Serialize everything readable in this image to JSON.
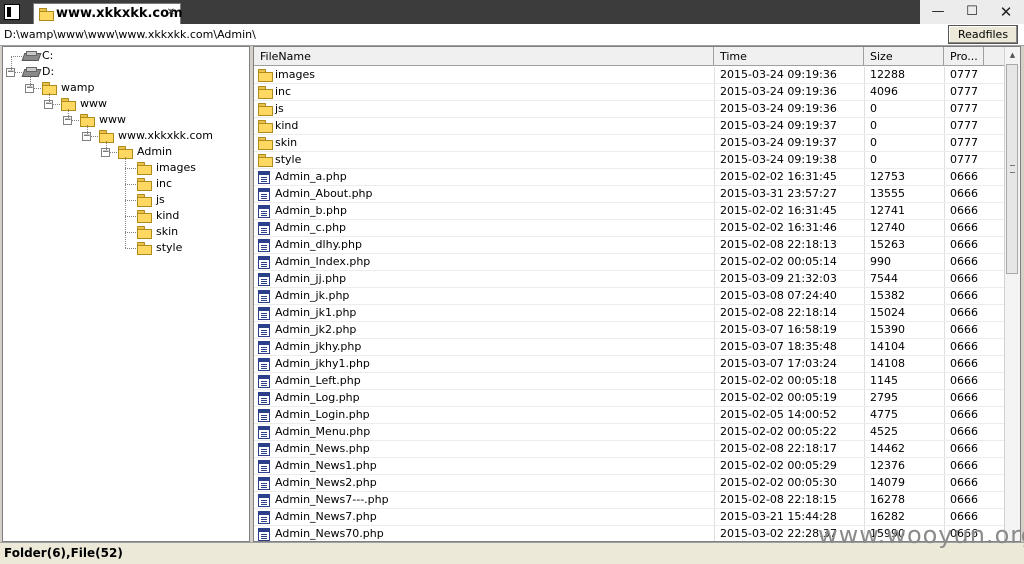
{
  "window": {
    "tab_title": "www.xkkxkk.com",
    "tab_close": "✕",
    "minimize": "—",
    "maximize": "☐",
    "close": "✕"
  },
  "pathbar": {
    "path": "D:\\wamp\\www\\www\\www.xkkxkk.com\\Admin\\",
    "readfiles_label": "Readfiles"
  },
  "tree": [
    {
      "label": "C:",
      "icon": "drive-icon",
      "depth": 0,
      "expander": "none"
    },
    {
      "label": "D:",
      "icon": "drive-icon",
      "depth": 0,
      "expander": "minus"
    },
    {
      "label": "wamp",
      "icon": "folder-icon",
      "depth": 1,
      "expander": "minus"
    },
    {
      "label": "www",
      "icon": "folder-icon",
      "depth": 2,
      "expander": "minus"
    },
    {
      "label": "www",
      "icon": "folder-icon",
      "depth": 3,
      "expander": "minus"
    },
    {
      "label": "www.xkkxkk.com",
      "icon": "folder-icon",
      "depth": 4,
      "expander": "minus"
    },
    {
      "label": "Admin",
      "icon": "folder-icon",
      "depth": 5,
      "expander": "minus"
    },
    {
      "label": "images",
      "icon": "folder-icon",
      "depth": 6,
      "expander": "none"
    },
    {
      "label": "inc",
      "icon": "folder-icon",
      "depth": 6,
      "expander": "none"
    },
    {
      "label": "js",
      "icon": "folder-icon",
      "depth": 6,
      "expander": "none"
    },
    {
      "label": "kind",
      "icon": "folder-icon",
      "depth": 6,
      "expander": "none"
    },
    {
      "label": "skin",
      "icon": "folder-icon",
      "depth": 6,
      "expander": "none"
    },
    {
      "label": "style",
      "icon": "folder-icon",
      "depth": 6,
      "expander": "none"
    }
  ],
  "file_list": {
    "columns": [
      "FileName",
      "Time",
      "Size",
      "Pro..."
    ],
    "rows": [
      {
        "type": "folder",
        "name": "images",
        "time": "2015-03-24 09:19:36",
        "size": "12288",
        "prop": "0777"
      },
      {
        "type": "folder",
        "name": "inc",
        "time": "2015-03-24 09:19:36",
        "size": "4096",
        "prop": "0777"
      },
      {
        "type": "folder",
        "name": "js",
        "time": "2015-03-24 09:19:36",
        "size": "0",
        "prop": "0777"
      },
      {
        "type": "folder",
        "name": "kind",
        "time": "2015-03-24 09:19:37",
        "size": "0",
        "prop": "0777"
      },
      {
        "type": "folder",
        "name": "skin",
        "time": "2015-03-24 09:19:37",
        "size": "0",
        "prop": "0777"
      },
      {
        "type": "folder",
        "name": "style",
        "time": "2015-03-24 09:19:38",
        "size": "0",
        "prop": "0777"
      },
      {
        "type": "file",
        "name": "Admin_a.php",
        "time": "2015-02-02 16:31:45",
        "size": "12753",
        "prop": "0666"
      },
      {
        "type": "file",
        "name": "Admin_About.php",
        "time": "2015-03-31 23:57:27",
        "size": "13555",
        "prop": "0666"
      },
      {
        "type": "file",
        "name": "Admin_b.php",
        "time": "2015-02-02 16:31:45",
        "size": "12741",
        "prop": "0666"
      },
      {
        "type": "file",
        "name": "Admin_c.php",
        "time": "2015-02-02 16:31:46",
        "size": "12740",
        "prop": "0666"
      },
      {
        "type": "file",
        "name": "Admin_dlhy.php",
        "time": "2015-02-08 22:18:13",
        "size": "15263",
        "prop": "0666"
      },
      {
        "type": "file",
        "name": "Admin_Index.php",
        "time": "2015-02-02 00:05:14",
        "size": "990",
        "prop": "0666"
      },
      {
        "type": "file",
        "name": "Admin_jj.php",
        "time": "2015-03-09 21:32:03",
        "size": "7544",
        "prop": "0666"
      },
      {
        "type": "file",
        "name": "Admin_jk.php",
        "time": "2015-03-08 07:24:40",
        "size": "15382",
        "prop": "0666"
      },
      {
        "type": "file",
        "name": "Admin_jk1.php",
        "time": "2015-02-08 22:18:14",
        "size": "15024",
        "prop": "0666"
      },
      {
        "type": "file",
        "name": "Admin_jk2.php",
        "time": "2015-03-07 16:58:19",
        "size": "15390",
        "prop": "0666"
      },
      {
        "type": "file",
        "name": "Admin_jkhy.php",
        "time": "2015-03-07 18:35:48",
        "size": "14104",
        "prop": "0666"
      },
      {
        "type": "file",
        "name": "Admin_jkhy1.php",
        "time": "2015-03-07 17:03:24",
        "size": "14108",
        "prop": "0666"
      },
      {
        "type": "file",
        "name": "Admin_Left.php",
        "time": "2015-02-02 00:05:18",
        "size": "1145",
        "prop": "0666"
      },
      {
        "type": "file",
        "name": "Admin_Log.php",
        "time": "2015-02-02 00:05:19",
        "size": "2795",
        "prop": "0666"
      },
      {
        "type": "file",
        "name": "Admin_Login.php",
        "time": "2015-02-05 14:00:52",
        "size": "4775",
        "prop": "0666"
      },
      {
        "type": "file",
        "name": "Admin_Menu.php",
        "time": "2015-02-02 00:05:22",
        "size": "4525",
        "prop": "0666"
      },
      {
        "type": "file",
        "name": "Admin_News.php",
        "time": "2015-02-08 22:18:17",
        "size": "14462",
        "prop": "0666"
      },
      {
        "type": "file",
        "name": "Admin_News1.php",
        "time": "2015-02-02 00:05:29",
        "size": "12376",
        "prop": "0666"
      },
      {
        "type": "file",
        "name": "Admin_News2.php",
        "time": "2015-02-02 00:05:30",
        "size": "14079",
        "prop": "0666"
      },
      {
        "type": "file",
        "name": "Admin_News7---.php",
        "time": "2015-02-08 22:18:15",
        "size": "16278",
        "prop": "0666"
      },
      {
        "type": "file",
        "name": "Admin_News7.php",
        "time": "2015-03-21 15:44:28",
        "size": "16282",
        "prop": "0666"
      },
      {
        "type": "file",
        "name": "Admin_News70.php",
        "time": "2015-03-02 22:28:37",
        "size": "15990",
        "prop": "0666"
      }
    ]
  },
  "status": {
    "text": "Folder(6),File(52)"
  },
  "watermark": "www.wooyun.org"
}
